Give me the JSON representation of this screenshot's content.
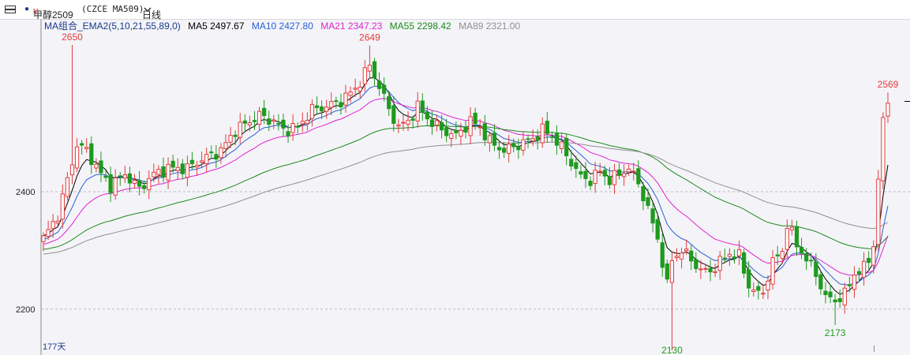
{
  "header": {
    "instrument_name": "甲醇2509",
    "superscript": "M",
    "code": "(CZCE MA509)",
    "period": "日线",
    "period_dropdown_icon": "chevron-down-icon",
    "menu_icon": "collapse-toggle-icon"
  },
  "legend": {
    "title": "MA组合_EMA2(5,10,21,55,89,0)",
    "items": [
      {
        "label": "MA5 2497.67",
        "color": "#000000"
      },
      {
        "label": "MA10 2427.80",
        "color": "#2a5fd6"
      },
      {
        "label": "MA21 2347.23",
        "color": "#e020d0"
      },
      {
        "label": "MA55 2298.42",
        "color": "#1c8a1c"
      },
      {
        "label": "MA89 2321.00",
        "color": "#909090"
      }
    ]
  },
  "footer": {
    "days_label": "177天"
  },
  "colors": {
    "up": "#e23b3b",
    "down": "#1f9a1f",
    "grid": "#b8b8c8",
    "text": "#222222"
  },
  "chart_data": {
    "type": "candlestick",
    "ylim": [
      2130,
      2670
    ],
    "yticks": [
      2200,
      2400
    ],
    "grid_lines_at": [
      2200,
      2400
    ],
    "peak_labels": [
      {
        "label": "2650",
        "value": 2650,
        "index": 6,
        "color": "#e23b3b",
        "position": "above"
      },
      {
        "label": "2649",
        "value": 2649,
        "index": 68,
        "color": "#e23b3b",
        "position": "above"
      },
      {
        "label": "2130",
        "value": 2130,
        "index": 131,
        "color": "#1f9a1f",
        "position": "below"
      },
      {
        "label": "2173",
        "value": 2173,
        "index": 165,
        "color": "#1f9a1f",
        "position": "below"
      },
      {
        "label": "2569",
        "value": 2569,
        "index": 176,
        "color": "#e23b3b",
        "position": "above"
      }
    ],
    "close_anchors": [
      [
        0,
        2320
      ],
      [
        3,
        2360
      ],
      [
        5,
        2420
      ],
      [
        7,
        2480
      ],
      [
        9,
        2470
      ],
      [
        12,
        2430
      ],
      [
        14,
        2410
      ],
      [
        17,
        2430
      ],
      [
        20,
        2405
      ],
      [
        23,
        2430
      ],
      [
        26,
        2440
      ],
      [
        30,
        2440
      ],
      [
        33,
        2455
      ],
      [
        37,
        2470
      ],
      [
        40,
        2505
      ],
      [
        45,
        2530
      ],
      [
        48,
        2520
      ],
      [
        50,
        2505
      ],
      [
        53,
        2510
      ],
      [
        56,
        2540
      ],
      [
        59,
        2545
      ],
      [
        62,
        2555
      ],
      [
        65,
        2575
      ],
      [
        68,
        2615
      ],
      [
        70,
        2580
      ],
      [
        72,
        2540
      ],
      [
        74,
        2510
      ],
      [
        76,
        2520
      ],
      [
        78,
        2545
      ],
      [
        80,
        2525
      ],
      [
        83,
        2505
      ],
      [
        86,
        2495
      ],
      [
        89,
        2520
      ],
      [
        91,
        2510
      ],
      [
        93,
        2485
      ],
      [
        96,
        2470
      ],
      [
        99,
        2480
      ],
      [
        102,
        2490
      ],
      [
        104,
        2505
      ],
      [
        106,
        2495
      ],
      [
        108,
        2475
      ],
      [
        110,
        2450
      ],
      [
        112,
        2425
      ],
      [
        114,
        2420
      ],
      [
        116,
        2435
      ],
      [
        118,
        2420
      ],
      [
        120,
        2430
      ],
      [
        122,
        2440
      ],
      [
        124,
        2415
      ],
      [
        126,
        2370
      ],
      [
        128,
        2320
      ],
      [
        130,
        2240
      ],
      [
        131,
        2285
      ],
      [
        133,
        2300
      ],
      [
        135,
        2285
      ],
      [
        137,
        2265
      ],
      [
        139,
        2265
      ],
      [
        141,
        2280
      ],
      [
        143,
        2295
      ],
      [
        145,
        2290
      ],
      [
        147,
        2240
      ],
      [
        149,
        2225
      ],
      [
        150,
        2230
      ],
      [
        152,
        2280
      ],
      [
        154,
        2300
      ],
      [
        155,
        2345
      ],
      [
        157,
        2310
      ],
      [
        159,
        2285
      ],
      [
        161,
        2260
      ],
      [
        163,
        2220
      ],
      [
        165,
        2215
      ],
      [
        167,
        2225
      ],
      [
        169,
        2260
      ],
      [
        171,
        2270
      ],
      [
        172,
        2285
      ],
      [
        173,
        2310
      ],
      [
        174,
        2420
      ],
      [
        175,
        2520
      ],
      [
        176,
        2555
      ]
    ]
  }
}
